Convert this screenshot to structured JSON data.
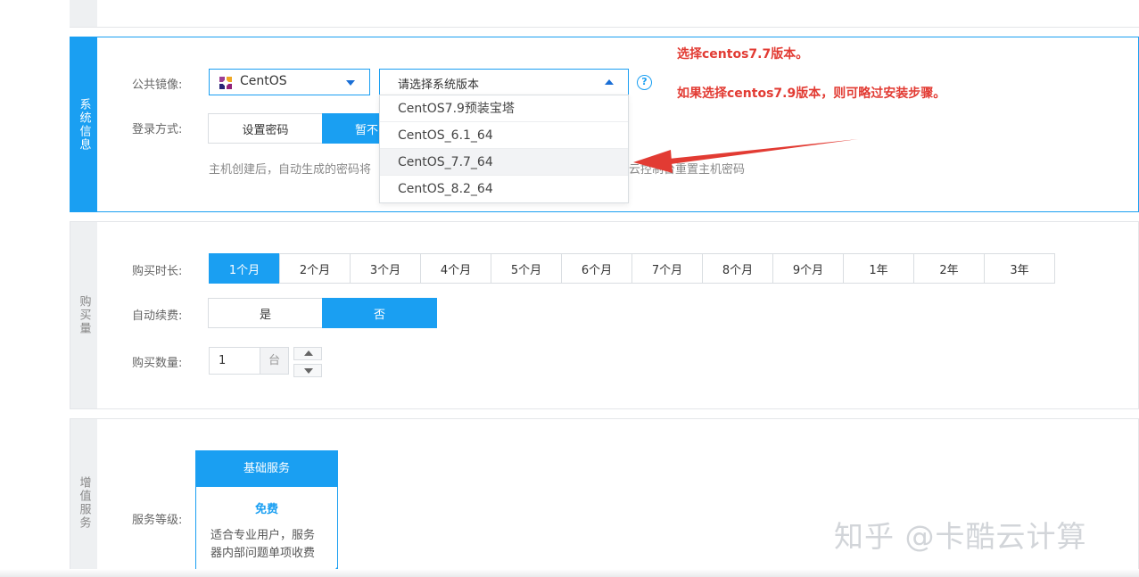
{
  "system_section": {
    "tab_label": "系统信息",
    "public_image_label": "公共镜像:",
    "image_value": "CentOS",
    "version_placeholder": "请选择系统版本",
    "versions": [
      "CentOS7.9预装宝塔",
      "CentOS_6.1_64",
      "CentOS_7.7_64",
      "CentOS_8.2_64"
    ],
    "login_label": "登录方式:",
    "login_options": [
      "设置密码",
      "暂不"
    ],
    "hint": "主机创建后，自动生成的密码将",
    "hint_tail": "卡酷云控制台重置主机密码"
  },
  "annotations": {
    "line1": "选择centos7.7版本。",
    "line2": "如果选择centos7.9版本，则可略过安装步骤。",
    "arrow_color": "#e23b33"
  },
  "purchase_section": {
    "tab_label": "购买量",
    "duration_label": "购买时长:",
    "durations": [
      "1个月",
      "2个月",
      "3个月",
      "4个月",
      "5个月",
      "6个月",
      "7个月",
      "8个月",
      "9个月",
      "1年",
      "2年",
      "3年"
    ],
    "autorenew_label": "自动续费:",
    "autorenew_options": [
      "是",
      "否"
    ],
    "quantity_label": "购买数量:",
    "quantity_value": "1",
    "quantity_unit": "台"
  },
  "value_added_section": {
    "tab_label": "增值服务",
    "service_level_label": "服务等级:",
    "card_title": "基础服务",
    "card_price": "免费",
    "card_desc": "适合专业用户，服务器内部问题单项收费"
  },
  "watermark": "知乎 @卡酷云计算",
  "colors": {
    "accent": "#1a9ff2",
    "annotation": "#e23b33"
  }
}
